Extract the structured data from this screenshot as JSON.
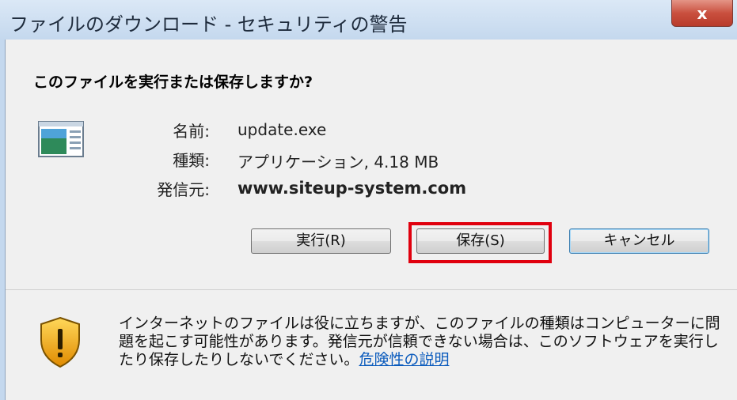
{
  "window": {
    "title": "ファイルのダウンロード - セキュリティの警告",
    "close_label": "x"
  },
  "dialog": {
    "question": "このファイルを実行または保存しますか?",
    "file_icon": "application-file-icon",
    "fields": {
      "name_label": "名前:",
      "name_value": "update.exe",
      "type_label": "種類:",
      "type_value": "アプリケーション, 4.18 MB",
      "from_label": "発信元:",
      "from_value": "www.siteup-system.com"
    },
    "buttons": {
      "run": "実行(R)",
      "save": "保存(S)",
      "cancel": "キャンセル"
    },
    "highlight_color": "#e0000e"
  },
  "warning": {
    "icon": "security-shield-icon",
    "text": "インターネットのファイルは役に立ちますが、このファイルの種類はコンピューターに問題を起こす可能性があります。発信元が信頼できない場合は、このソフトウェアを実行したり保存したりしないでください。",
    "link": "危険性の説明"
  }
}
